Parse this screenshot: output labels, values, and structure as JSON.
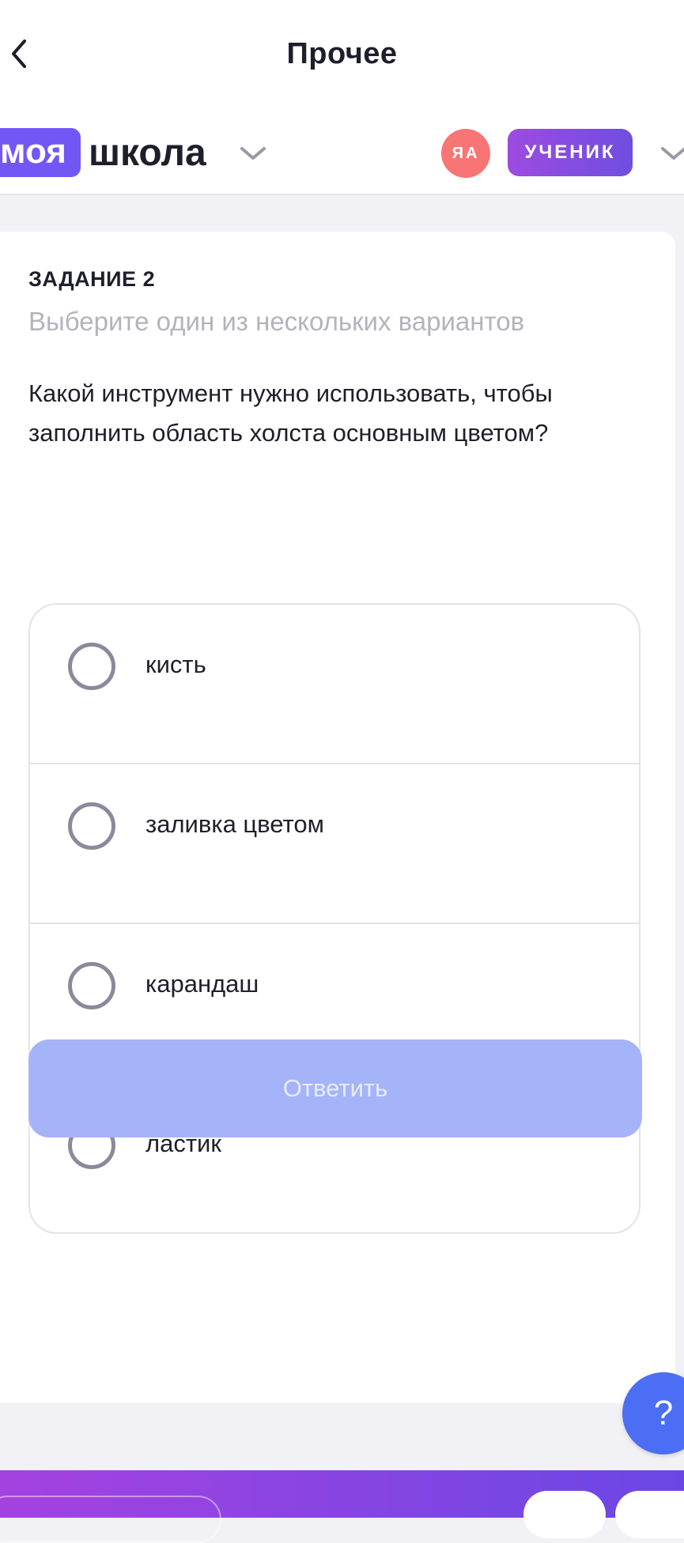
{
  "header": {
    "title": "Прочее"
  },
  "school": {
    "logo_part1": "моя",
    "logo_part2": "школа"
  },
  "user": {
    "initials": "ЯА",
    "role": "УЧЕНИК"
  },
  "task": {
    "label": "ЗАДАНИЕ 2",
    "hint": "Выберите один из нескольких вариантов",
    "question": "Какой инструмент нужно использовать, чтобы заполнить область холста основным цветом?",
    "options": [
      "кисть",
      "заливка цветом",
      "карандаш",
      "ластик"
    ],
    "submit_label": "Ответить"
  },
  "help": {
    "label": "?"
  },
  "colors": {
    "accent": "#7357f6",
    "button_disabled": "#a5b4f8",
    "avatar": "#f87575",
    "help": "#4c6ef5"
  }
}
